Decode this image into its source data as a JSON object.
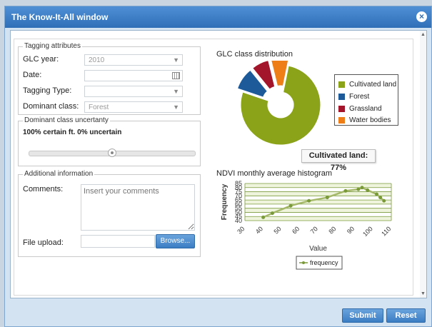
{
  "window": {
    "title": "The Know-It-All window"
  },
  "tagging": {
    "legend": "Tagging attributes",
    "glc_year_label": "GLC year:",
    "glc_year_value": "2010",
    "date_label": "Date:",
    "date_value": "",
    "tagging_type_label": "Tagging Type:",
    "tagging_type_value": "",
    "dominant_class_label": "Dominant class:",
    "dominant_class_value": "Forest"
  },
  "uncertainty": {
    "legend": "Dominant class uncertanty",
    "text": "100% certain ft. 0% uncertain",
    "slider_value": 0.5
  },
  "additional": {
    "legend": "Additional information",
    "comments_label": "Comments:",
    "comments_placeholder": "Insert your comments",
    "file_upload_label": "File upload:",
    "browse_label": "Browse..."
  },
  "pie_section": {
    "title": "GLC class distribution"
  },
  "histogram_section": {
    "title": "NDVI monthly average histogram"
  },
  "tooltip": {
    "text": "Cultivated land: 77%"
  },
  "footer": {
    "submit_label": "Submit",
    "reset_label": "Reset"
  },
  "colors": {
    "title_bar": "#3a7cc4",
    "button": "#4a8bd0",
    "cultivated": "#8aa318",
    "forest": "#1d5a99",
    "grassland": "#a3152b",
    "water": "#ee7e18",
    "line": "#7a9a3a"
  },
  "chart_data": [
    {
      "type": "pie",
      "title": "GLC class distribution",
      "labels": [
        "Cultivated land",
        "Forest",
        "Grassland",
        "Water bodies"
      ],
      "values": [
        77,
        9,
        7,
        7
      ],
      "colors": [
        "#8aa318",
        "#1d5a99",
        "#a3152b",
        "#ee7e18"
      ],
      "donut": true,
      "exploded": [
        "Forest",
        "Grassland",
        "Water bodies"
      ],
      "legend_position": "right"
    },
    {
      "type": "line",
      "title": "NDVI monthly average histogram",
      "xlabel": "Value",
      "ylabel": "Frequency",
      "x_ticks": [
        30,
        40,
        50,
        60,
        70,
        80,
        90,
        100,
        110
      ],
      "y_ticks": [
        40,
        45,
        50,
        55,
        60,
        65,
        70,
        75,
        80,
        85
      ],
      "xlim": [
        30,
        110
      ],
      "ylim": [
        40,
        85
      ],
      "series": [
        {
          "name": "frequency",
          "x": [
            40,
            45,
            55,
            65,
            75,
            85,
            92,
            94,
            97,
            102,
            104,
            106
          ],
          "y": [
            44,
            49,
            58,
            64,
            68,
            76,
            78,
            80,
            77,
            72,
            68,
            64
          ]
        }
      ],
      "legend_position": "bottom"
    }
  ]
}
